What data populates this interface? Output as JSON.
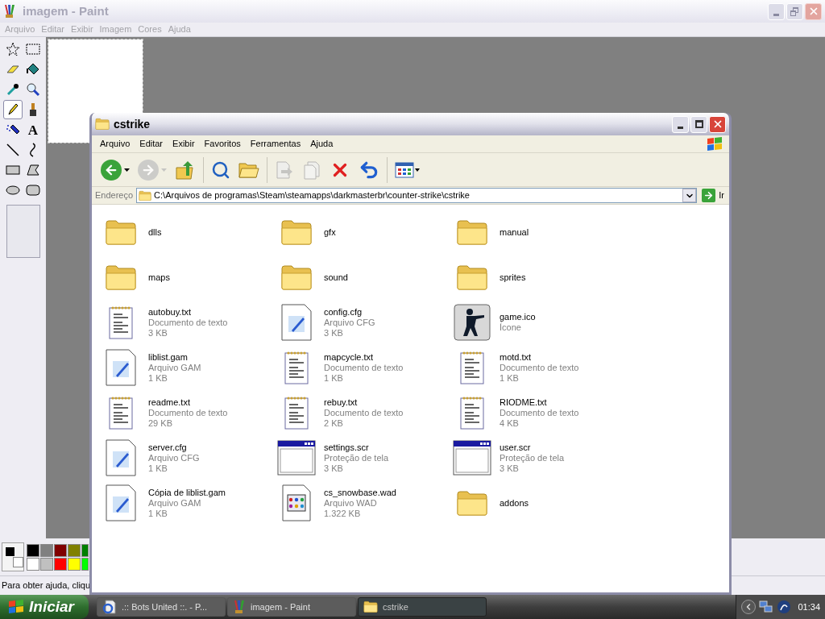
{
  "paint": {
    "title": "imagem - Paint",
    "active": false,
    "menu": [
      "Arquivo",
      "Editar",
      "Exibir",
      "Imagem",
      "Cores",
      "Ajuda"
    ],
    "tools": [
      {
        "kind": "free-select",
        "selected": false
      },
      {
        "kind": "select",
        "selected": false
      },
      {
        "kind": "eraser",
        "selected": false
      },
      {
        "kind": "fill",
        "selected": false
      },
      {
        "kind": "picker",
        "selected": false
      },
      {
        "kind": "magnifier",
        "selected": false
      },
      {
        "kind": "pencil",
        "selected": true
      },
      {
        "kind": "brush",
        "selected": false
      },
      {
        "kind": "airbrush",
        "selected": false
      },
      {
        "kind": "text",
        "glyph": "A",
        "selected": false
      },
      {
        "kind": "line",
        "selected": false
      },
      {
        "kind": "curve",
        "selected": false
      },
      {
        "kind": "rectangle",
        "selected": false
      },
      {
        "kind": "polygon",
        "selected": false
      },
      {
        "kind": "ellipse",
        "selected": false
      },
      {
        "kind": "rounded-rectangle",
        "selected": false
      }
    ],
    "palette": {
      "current": [
        {
          "kind": "foreground",
          "color": "#000000"
        },
        {
          "kind": "background",
          "color": "#ffffff"
        }
      ],
      "colors": [
        {
          "color": "#000000"
        },
        {
          "color": "#808080"
        },
        {
          "color": "#800000"
        },
        {
          "color": "#808000"
        },
        {
          "color": "#008000"
        },
        {
          "color": "#ffffff"
        },
        {
          "color": "#c0c0c0"
        },
        {
          "color": "#ff0000"
        },
        {
          "color": "#ffff00"
        },
        {
          "color": "#00ff00"
        }
      ]
    },
    "status_bar": "Para obter ajuda, cliqu"
  },
  "explorer": {
    "title": "cstrike",
    "active": true,
    "menu": [
      "Arquivo",
      "Editar",
      "Exibir",
      "Favoritos",
      "Ferramentas",
      "Ajuda"
    ],
    "toolbar": [
      {
        "kind": "back",
        "disabled": false
      },
      {
        "kind": "forward",
        "disabled": true
      },
      {
        "kind": "up",
        "disabled": false
      },
      {
        "kind": "search",
        "disabled": false
      },
      {
        "kind": "folders",
        "disabled": false
      },
      {
        "kind": "move",
        "disabled": true
      },
      {
        "kind": "copy",
        "disabled": true
      },
      {
        "kind": "delete",
        "disabled": false
      },
      {
        "kind": "undo",
        "disabled": false
      },
      {
        "kind": "views",
        "disabled": false
      }
    ],
    "address": {
      "label": "Endereço",
      "value": "C:\\Arquivos de programas\\Steam\\steamapps\\darkmasterbr\\counter-strike\\cstrike",
      "go": "Ir"
    },
    "files": [
      {
        "kind": "folder",
        "name": "dlls"
      },
      {
        "kind": "folder",
        "name": "gfx"
      },
      {
        "kind": "folder",
        "name": "manual"
      },
      {
        "kind": "folder",
        "name": "maps"
      },
      {
        "kind": "folder",
        "name": "sound"
      },
      {
        "kind": "folder",
        "name": "sprites"
      },
      {
        "kind": "text",
        "name": "autobuy.txt",
        "type": "Documento de texto",
        "size": "3 KB"
      },
      {
        "kind": "config",
        "name": "config.cfg",
        "type": "Arquivo CFG",
        "size": "3 KB"
      },
      {
        "kind": "icon",
        "name": "game.ico",
        "type": "Ícone"
      },
      {
        "kind": "config",
        "name": "liblist.gam",
        "type": "Arquivo GAM",
        "size": "1 KB"
      },
      {
        "kind": "text",
        "name": "mapcycle.txt",
        "type": "Documento de texto",
        "size": "1 KB"
      },
      {
        "kind": "text",
        "name": "motd.txt",
        "type": "Documento de texto",
        "size": "1 KB"
      },
      {
        "kind": "text",
        "name": "readme.txt",
        "type": "Documento de texto",
        "size": "29 KB"
      },
      {
        "kind": "text",
        "name": "rebuy.txt",
        "type": "Documento de texto",
        "size": "2 KB"
      },
      {
        "kind": "text",
        "name": "RIODME.txt",
        "type": "Documento de texto",
        "size": "4 KB"
      },
      {
        "kind": "config",
        "name": "server.cfg",
        "type": "Arquivo CFG",
        "size": "1 KB"
      },
      {
        "kind": "screensaver",
        "name": "settings.scr",
        "type": "Proteção de tela",
        "size": "3 KB"
      },
      {
        "kind": "screensaver",
        "name": "user.scr",
        "type": "Proteção de tela",
        "size": "3 KB"
      },
      {
        "kind": "config",
        "name": "Cópia de liblist.gam",
        "type": "Arquivo GAM",
        "size": "1 KB"
      },
      {
        "kind": "wad",
        "name": "cs_snowbase.wad",
        "type": "Arquivo WAD",
        "size": "1.322 KB"
      },
      {
        "kind": "folder",
        "name": "addons"
      }
    ]
  },
  "taskbar": {
    "start": "Iniciar",
    "tasks": [
      {
        "kind": "browser",
        "label": ".:: Bots United ::. - P...",
        "selected": false
      },
      {
        "kind": "paint",
        "label": "imagem - Paint",
        "selected": false
      },
      {
        "kind": "folder",
        "label": "cstrike",
        "selected": true
      }
    ],
    "clock": "01:34"
  }
}
